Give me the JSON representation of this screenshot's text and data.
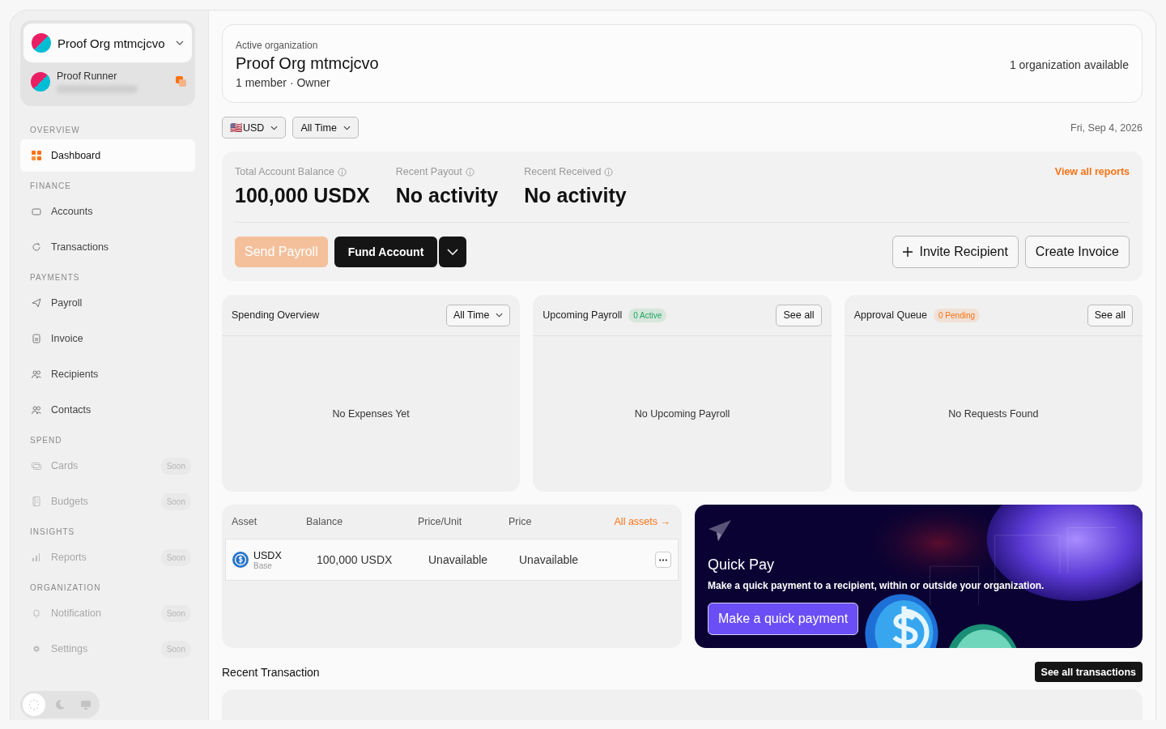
{
  "org_switcher": {
    "name": "Proof Org mtmcjcvo"
  },
  "user": {
    "name": "Proof Runner"
  },
  "sidebar": {
    "sections": [
      {
        "title": "OVERVIEW",
        "items": [
          {
            "label": "Dashboard",
            "selected": true,
            "disabled": false
          }
        ]
      },
      {
        "title": "FINANCE",
        "items": [
          {
            "label": "Accounts",
            "selected": false,
            "disabled": false
          },
          {
            "label": "Transactions",
            "selected": false,
            "disabled": false
          }
        ]
      },
      {
        "title": "PAYMENTS",
        "items": [
          {
            "label": "Payroll",
            "selected": false,
            "disabled": false
          },
          {
            "label": "Invoice",
            "selected": false,
            "disabled": false
          },
          {
            "label": "Recipients",
            "selected": false,
            "disabled": false
          },
          {
            "label": "Contacts",
            "selected": false,
            "disabled": false
          }
        ]
      },
      {
        "title": "SPEND",
        "items": [
          {
            "label": "Cards",
            "selected": false,
            "disabled": true,
            "badge": "Soon"
          },
          {
            "label": "Budgets",
            "selected": false,
            "disabled": true,
            "badge": "Soon"
          }
        ]
      },
      {
        "title": "INSIGHTS",
        "items": [
          {
            "label": "Reports",
            "selected": false,
            "disabled": true,
            "badge": "Soon"
          }
        ]
      },
      {
        "title": "ORGANIZATION",
        "items": [
          {
            "label": "Notification",
            "selected": false,
            "disabled": true,
            "badge": "Soon"
          },
          {
            "label": "Settings",
            "selected": false,
            "disabled": true,
            "badge": "Soon"
          }
        ]
      }
    ]
  },
  "theme_modes": [
    {
      "selected": true
    },
    {
      "selected": false
    },
    {
      "selected": false
    }
  ],
  "org_card": {
    "caption": "Active organization",
    "name": "Proof Org mtmcjcvo",
    "meta": "1 member · Owner",
    "available": "1 organization available"
  },
  "filters": [
    {
      "label": "🇺🇸USD"
    },
    {
      "label": "All Time"
    }
  ],
  "date": "Fri, Sep 4, 2026",
  "stats": [
    {
      "label": "Total Account Balance",
      "value": "100,000 USDX"
    },
    {
      "label": "Recent Payout",
      "value": "No activity"
    },
    {
      "label": "Recent Received",
      "value": "No activity"
    }
  ],
  "view_all_reports": "View all reports",
  "actions": {
    "send_payroll": {
      "label": "Send Payroll",
      "disabled": true
    },
    "fund_account": "Fund Account",
    "invite_recipient": "Invite Recipient",
    "create_invoice": "Create Invoice"
  },
  "panels": [
    {
      "title": "Spending Overview",
      "control": "All Time",
      "kind": "dropdown",
      "empty": "No Expenses Yet"
    },
    {
      "title": "Upcoming Payroll",
      "badge": "0 Active",
      "color": "#22a45d",
      "control": "See all",
      "kind": "button",
      "empty": "No Upcoming Payroll"
    },
    {
      "title": "Approval Queue",
      "badge": "0 Pending",
      "color": "#f97316",
      "control": "See all",
      "kind": "button",
      "empty": "No Requests Found"
    }
  ],
  "assets": {
    "columns": [
      "Asset",
      "Balance",
      "Price/Unit",
      "Price"
    ],
    "link": "All assets →",
    "rows": [
      {
        "asset": "USDX",
        "network": "Base",
        "balance": "100,000 USDX",
        "price_unit": "Unavailable",
        "price": "Unavailable"
      }
    ]
  },
  "quick_pay": {
    "title": "Quick Pay",
    "text": "Make a quick payment to a recipient, within or outside your organization.",
    "button": "Make a quick payment"
  },
  "recent": {
    "title": "Recent Transaction",
    "button": "See all transactions"
  }
}
